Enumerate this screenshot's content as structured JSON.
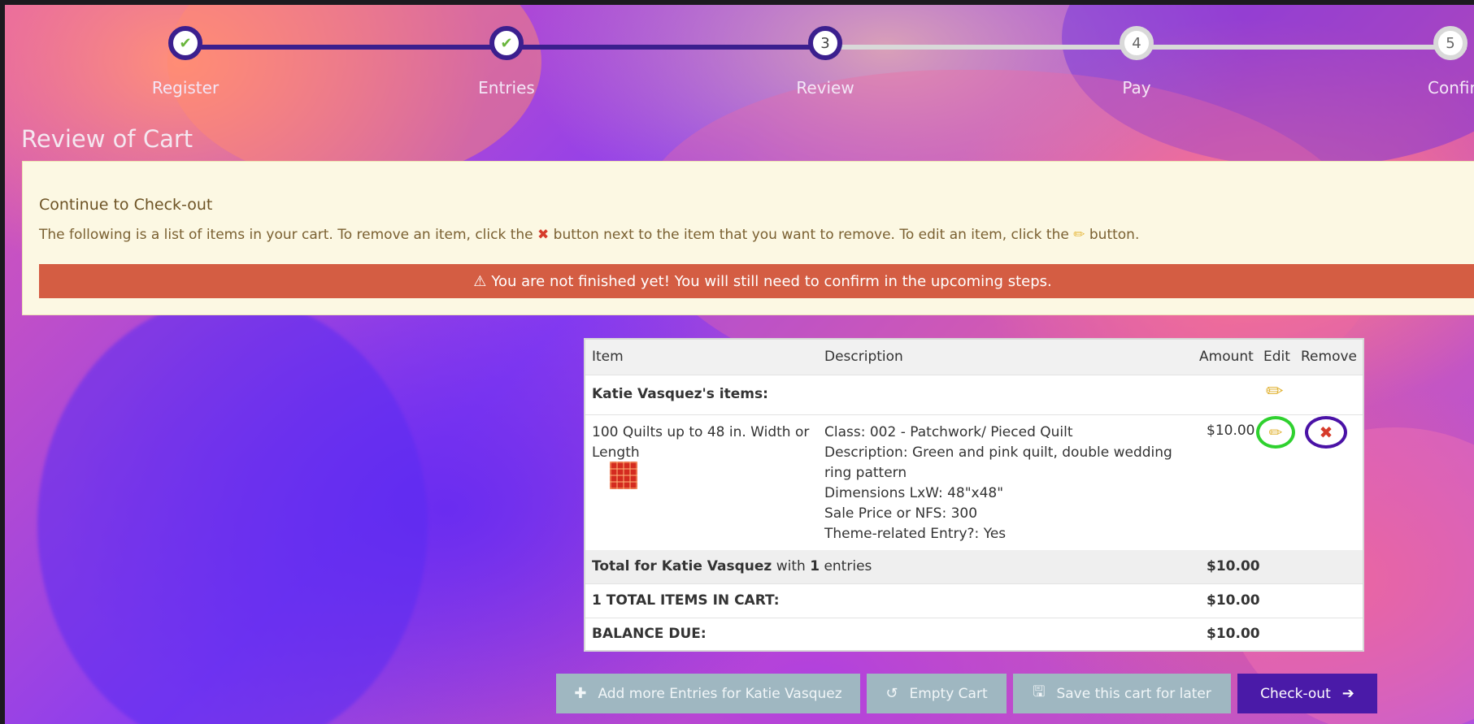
{
  "progress": {
    "steps": [
      {
        "label": "Register",
        "state": "done",
        "number": ""
      },
      {
        "label": "Entries",
        "state": "done",
        "number": ""
      },
      {
        "label": "Review",
        "state": "current",
        "number": "3"
      },
      {
        "label": "Pay",
        "state": "todo",
        "number": "4"
      },
      {
        "label": "Confirm",
        "state": "todo",
        "number": "5"
      }
    ]
  },
  "page": {
    "title": "Review of Cart"
  },
  "notice": {
    "heading": "Continue to Check-out",
    "text_before_x": "The following is a list of items in your cart. To remove an item, click the",
    "text_after_x": "button next to the item that you want to remove. To edit an item, click the",
    "text_after_pencil": "button.",
    "warning": "You are not finished yet! You will still need to confirm in the upcoming steps."
  },
  "cart": {
    "headers": {
      "item": "Item",
      "description": "Description",
      "amount": "Amount",
      "edit": "Edit",
      "remove": "Remove"
    },
    "owner_label": "Katie Vasquez's items:",
    "item": {
      "name": "100 Quilts up to 48 in. Width or Length",
      "description_lines": [
        "Class: 002 - Patchwork/ Pieced Quilt",
        "Description: Green and pink quilt, double wedding ring pattern",
        "Dimensions LxW: 48\"x48\"",
        "Sale Price or NFS: 300",
        "Theme-related Entry?: Yes"
      ],
      "amount": "$10.00"
    },
    "subtotal": {
      "prefix": "Total for Katie Vasquez",
      "middle": "with",
      "count": "1",
      "suffix": "entries",
      "amount": "$10.00"
    },
    "total": {
      "label": "1 TOTAL ITEMS IN CART:",
      "amount": "$10.00"
    },
    "balance": {
      "label": "BALANCE DUE:",
      "amount": "$10.00"
    }
  },
  "actions": {
    "add_more": "Add more Entries for Katie Vasquez",
    "empty_cart": "Empty Cart",
    "save_later": "Save this cart for later",
    "checkout": "Check-out"
  },
  "icons": {
    "check": "check-icon",
    "pencil": "pencil-icon",
    "remove": "x-icon",
    "warning": "warning-triangle-icon",
    "plus": "plus-icon",
    "undo": "undo-icon",
    "save": "floppy-disk-icon",
    "arrow": "arrow-right-icon"
  },
  "colors": {
    "step_done": "#3b1f8e",
    "step_todo": "#d9d9d9",
    "check": "#6ab63d",
    "notice_bg": "#fcf8e3",
    "warning_bg": "#d45d43",
    "edit_ring": "#2fd12f",
    "remove_ring": "#4a12a6",
    "primary_button": "#4a1aa8",
    "secondary_button": "#9fb7c1"
  }
}
